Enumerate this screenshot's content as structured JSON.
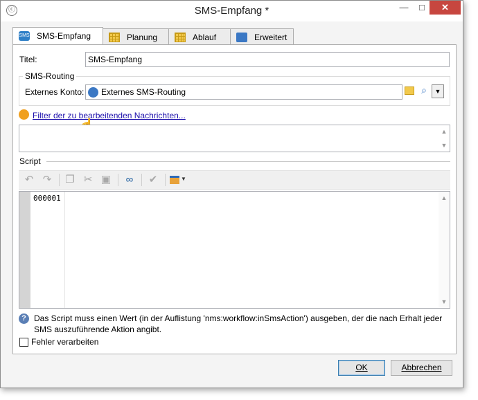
{
  "window": {
    "title": "SMS-Empfang *",
    "controls": {
      "minimize": "—",
      "maximize": "□",
      "close": "✕"
    }
  },
  "tabs": [
    {
      "label": "SMS-Empfang",
      "icon": "sms-icon",
      "active": true
    },
    {
      "label": "Planung",
      "icon": "calendar-icon"
    },
    {
      "label": "Ablauf",
      "icon": "calendar-icon"
    },
    {
      "label": "Erweitert",
      "icon": "clipboard-icon"
    }
  ],
  "form": {
    "title_label": "Titel:",
    "title_value": "SMS-Empfang",
    "routing_group": "SMS-Routing",
    "account_label": "Externes Konto:",
    "account_value": "Externes SMS-Routing",
    "filter_link": "Filter der zu bearbeitenden Nachrichten...",
    "script_label": "Script",
    "line_number": "000001",
    "help_text_line1": "Das Script muss einen Wert (in der Auflistung 'nms:workflow:inSmsAction') ausgeben, der die nach Erhalt jeder",
    "help_text_line2": "SMS auszuführende Aktion angibt.",
    "checkbox_label": "Fehler verarbeiten",
    "checkbox_checked": false
  },
  "buttons": {
    "ok": "OK",
    "cancel": "Abbrechen"
  },
  "colors": {
    "accent": "#2e7fc7",
    "link": "#1a0dab",
    "close": "#c7463f",
    "status_dot": "#f0a020"
  }
}
